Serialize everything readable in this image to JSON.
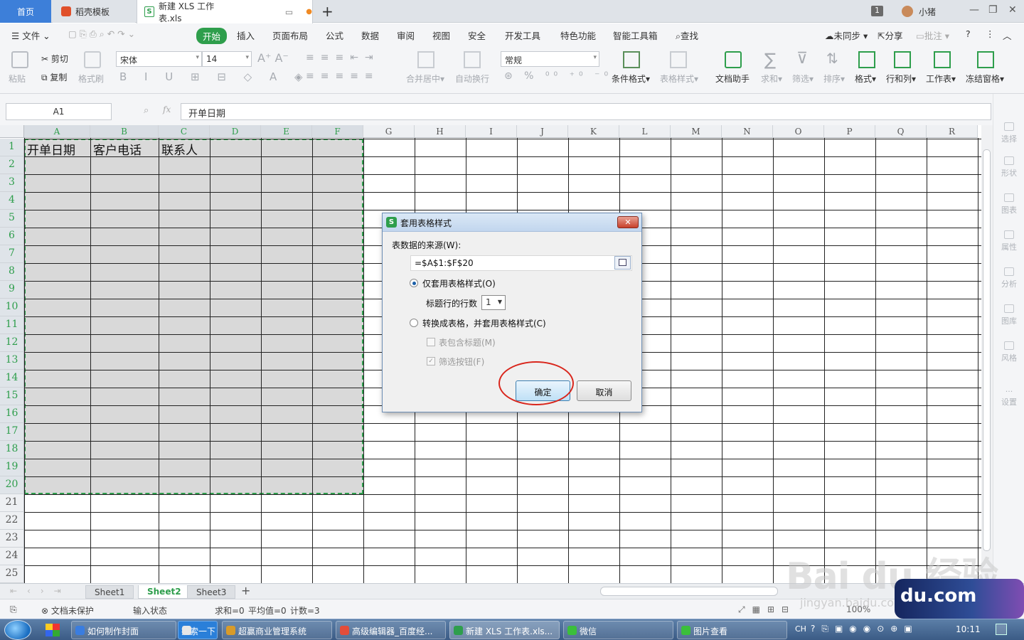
{
  "titlebar": {
    "tabs": [
      {
        "label": "首页"
      },
      {
        "label": "稻壳模板"
      },
      {
        "label": "新建 XLS 工作表.xls"
      }
    ],
    "badge_count": "1",
    "user": "小猪"
  },
  "menu": {
    "file": "文件",
    "items": [
      "开始",
      "插入",
      "页面布局",
      "公式",
      "数据",
      "审阅",
      "视图",
      "安全",
      "开发工具",
      "特色功能",
      "智能工具箱"
    ],
    "search": "查找",
    "sync": "未同步",
    "share": "分享",
    "comment": "批注"
  },
  "ribbon": {
    "paste": "粘贴",
    "cut": "剪切",
    "copy": "复制",
    "format_painter": "格式刷",
    "font": "宋体",
    "font_size": "14",
    "merge": "合并居中",
    "wrap": "自动换行",
    "number_format": "常规",
    "conditional_format": "条件格式",
    "table_style": "表格样式",
    "doc_helper": "文档助手",
    "sum": "求和",
    "filter": "筛选",
    "sort": "排序",
    "format": "格式",
    "rows_cols": "行和列",
    "worksheet": "工作表",
    "freeze": "冻结窗格"
  },
  "formula_bar": {
    "name_box": "A1",
    "fx": "fx",
    "content": "开单日期"
  },
  "sheet": {
    "columns": [
      "A",
      "B",
      "C",
      "D",
      "E",
      "F",
      "G",
      "H",
      "I",
      "J",
      "K",
      "L",
      "M",
      "N",
      "O",
      "P",
      "Q",
      "R"
    ],
    "rows": [
      "1",
      "2",
      "3",
      "4",
      "5",
      "6",
      "7",
      "8",
      "9",
      "10",
      "11",
      "12",
      "13",
      "14",
      "15",
      "16",
      "17",
      "18",
      "19",
      "20",
      "21",
      "22",
      "23",
      "24",
      "25"
    ],
    "cells": {
      "A1": "开单日期",
      "B1": "客户电话",
      "C1": "联系人"
    }
  },
  "sidebar": [
    "选择",
    "形状",
    "图表",
    "属性",
    "分析",
    "图库",
    "风格",
    "设置"
  ],
  "sheet_tabs": [
    "Sheet1",
    "Sheet2",
    "Sheet3"
  ],
  "active_sheet": "Sheet2",
  "status": {
    "protect": "文档未保护",
    "input_state": "输入状态",
    "sum": "求和=0",
    "avg": "平均值=0",
    "count": "计数=3",
    "zoom": "100%"
  },
  "dialog": {
    "title": "套用表格样式",
    "source_label": "表数据的来源(W):",
    "source_value": "=$A$1:$F$20",
    "option1": "仅套用表格样式(O)",
    "header_rows_label": "标题行的行数",
    "header_rows_value": "1",
    "option2": "转换成表格，并套用表格样式(C)",
    "chk_header": "表包含标题(M)",
    "chk_filter": "筛选按钮(F)",
    "ok": "确定",
    "cancel": "取消"
  },
  "taskbar": {
    "items": [
      "如何制作封面",
      "搜索一下",
      "超赢商业管理系统",
      "高级编辑器_百度经...",
      "新建 XLS 工作表.xls...",
      "微信",
      "图片查看"
    ],
    "lang": "CH",
    "time": "10:11"
  },
  "watermark": {
    "text": "Bai du 经验",
    "url": "jingyan.baidu.com",
    "badge": "du.com"
  },
  "colors": {
    "accent": "#2e9e4c",
    "tab_active": "#3d7fd9",
    "selection_fill": "#d9d9d9",
    "annotation": "#d9261c"
  }
}
